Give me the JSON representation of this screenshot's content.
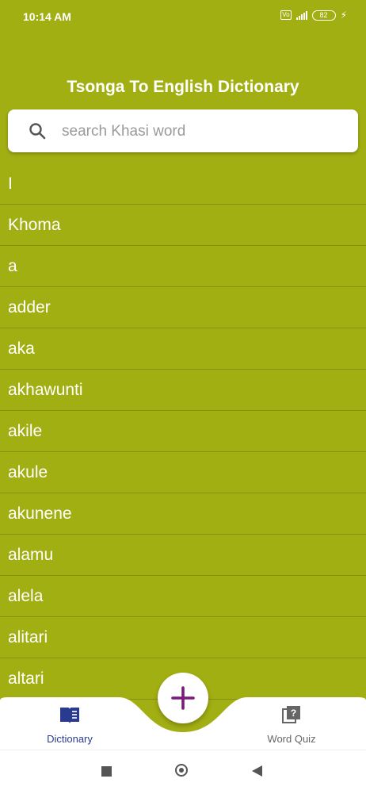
{
  "status_bar": {
    "time": "10:14 AM",
    "volte": "Vo LTE",
    "battery": "82"
  },
  "header": {
    "title": "Tsonga To English Dictionary"
  },
  "search": {
    "placeholder": "search Khasi word",
    "value": ""
  },
  "words": [
    "I",
    "Khoma",
    "a",
    "adder",
    "aka",
    "akhawunti",
    "akile",
    "akule",
    "akunene",
    "alamu",
    "alela",
    "alitari",
    "altari"
  ],
  "bottom_nav": {
    "dictionary_label": "Dictionary",
    "quiz_label": "Word Quiz",
    "active": "Dictionary"
  },
  "colors": {
    "background": "#a2af13",
    "active_nav": "#2a3b8f",
    "fab_plus": "#7a1a7a"
  },
  "icons": {
    "search": "search-icon",
    "dictionary": "book-icon",
    "quiz": "quiz-icon",
    "fab": "plus-icon"
  }
}
